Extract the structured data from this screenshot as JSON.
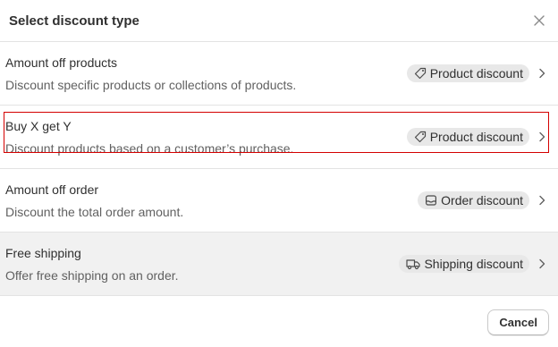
{
  "modal": {
    "title": "Select discount type",
    "close_icon": "close-icon"
  },
  "options": [
    {
      "name": "Amount off products",
      "description": "Discount specific products or collections of products.",
      "badge": "Product discount",
      "badge_icon": "tag-icon"
    },
    {
      "name": "Buy X get Y",
      "description": "Discount products based on a customer’s purchase.",
      "badge": "Product discount",
      "badge_icon": "tag-icon"
    },
    {
      "name": "Amount off order",
      "description": "Discount the total order amount.",
      "badge": "Order discount",
      "badge_icon": "cart-icon"
    },
    {
      "name": "Free shipping",
      "description": "Offer free shipping on an order.",
      "badge": "Shipping discount",
      "badge_icon": "truck-icon"
    }
  ],
  "footer": {
    "cancel_label": "Cancel"
  },
  "colors": {
    "highlight": "#d40000",
    "badge_bg": "#e8e8e8",
    "hover_bg": "#f1f1f1"
  }
}
